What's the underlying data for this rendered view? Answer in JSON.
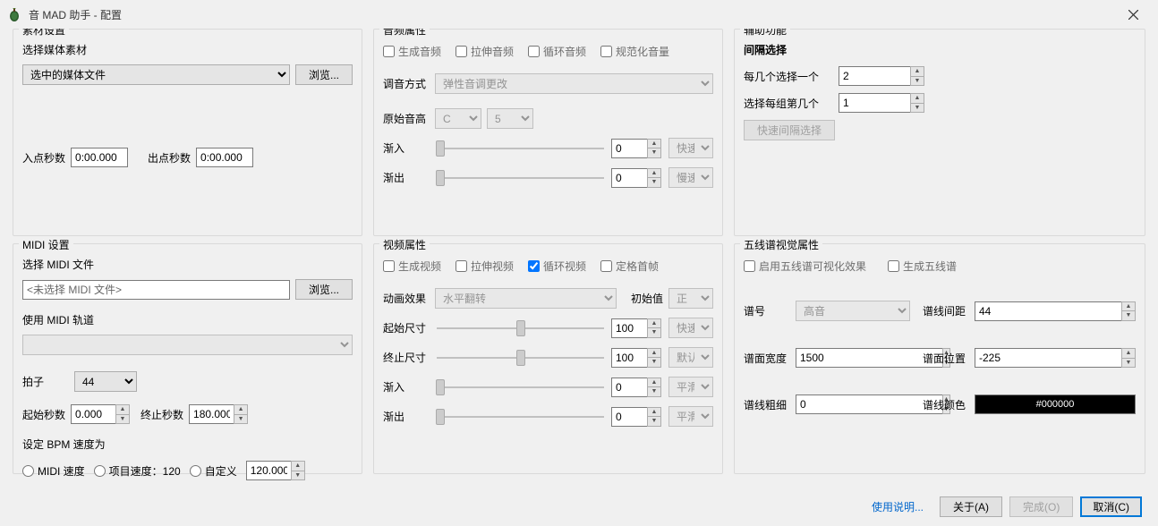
{
  "window": {
    "title": "音 MAD 助手 - 配置"
  },
  "material": {
    "group": "素材设置",
    "select_label": "选择媒体素材",
    "select_value": "选中的媒体文件",
    "browse": "浏览...",
    "in_label": "入点秒数",
    "in_value": "0:00.000",
    "out_label": "出点秒数",
    "out_value": "0:00.000"
  },
  "midi": {
    "group": "MIDI 设置",
    "file_label": "选择 MIDI 文件",
    "file_value": "<未选择 MIDI 文件>",
    "browse": "浏览...",
    "track_label": "使用 MIDI 轨道",
    "beat_label": "拍子",
    "beat_value": "44",
    "start_label": "起始秒数",
    "start_value": "0.000",
    "end_label": "终止秒数",
    "end_value": "180.000",
    "bpm_label": "设定 BPM 速度为",
    "bpm_midi": "MIDI 速度",
    "bpm_project": "项目速度：120",
    "bpm_custom": "自定义",
    "bpm_custom_value": "120.000"
  },
  "audio": {
    "group": "音频属性",
    "gen": "生成音频",
    "stretch": "拉伸音频",
    "loop": "循环音频",
    "norm": "规范化音量",
    "tune_method_label": "调音方式",
    "tune_method_value": "弹性音调更改",
    "base_pitch_label": "原始音高",
    "base_note": "C",
    "base_oct": "5",
    "fadein_label": "渐入",
    "fadein_value": "0",
    "fadein_curve": "快速",
    "fadeout_label": "渐出",
    "fadeout_value": "0",
    "fadeout_curve": "慢速"
  },
  "video": {
    "group": "视频属性",
    "gen": "生成视频",
    "stretch": "拉伸视频",
    "loop": "循环视频",
    "freeze": "定格首帧",
    "anim_label": "动画效果",
    "anim_value": "水平翻转",
    "init_label": "初始值",
    "init_value": "正",
    "start_size_label": "起始尺寸",
    "start_size_value": "100",
    "start_size_curve": "快速",
    "end_size_label": "终止尺寸",
    "end_size_value": "100",
    "end_size_curve": "默认",
    "fadein_label": "渐入",
    "fadein_value": "0",
    "fadein_curve": "平滑",
    "fadeout_label": "渐出",
    "fadeout_value": "0",
    "fadeout_curve": "平滑"
  },
  "aux": {
    "group": "辅助功能",
    "interval_label": "间隔选择",
    "every_label": "每几个选择一个",
    "every_value": "2",
    "which_label": "选择每组第几个",
    "which_value": "1",
    "quick_btn": "快速间隔选择"
  },
  "staff": {
    "group": "五线谱视觉属性",
    "enable": "启用五线谱可视化效果",
    "gen": "生成五线谱",
    "clef_label": "谱号",
    "clef_value": "高音",
    "line_spacing_label": "谱线间距",
    "line_spacing_value": "44",
    "width_label": "谱面宽度",
    "width_value": "1500",
    "position_label": "谱面位置",
    "position_value": "-225",
    "thick_label": "谱线粗细",
    "thick_value": "0",
    "color_label": "谱线颜色",
    "color_value": "#000000"
  },
  "footer": {
    "help": "使用说明...",
    "about": "关于(A)",
    "done": "完成(O)",
    "cancel": "取消(C)"
  }
}
